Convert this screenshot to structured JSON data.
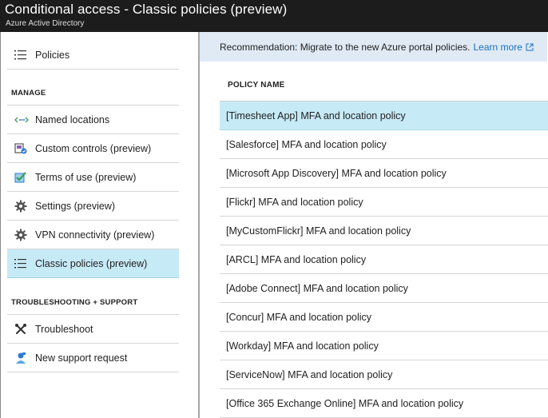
{
  "window": {
    "title": "Conditional access - Classic policies (preview)",
    "subtitle": "Azure Active Directory"
  },
  "sidebar": {
    "top_item": {
      "label": "Policies",
      "icon": "list-icon"
    },
    "manage_header": "MANAGE",
    "manage_items": [
      {
        "label": "Named locations",
        "icon": "named-locations-icon"
      },
      {
        "label": "Custom controls (preview)",
        "icon": "custom-controls-icon"
      },
      {
        "label": "Terms of use (preview)",
        "icon": "terms-of-use-icon"
      },
      {
        "label": "Settings (preview)",
        "icon": "gear-icon"
      },
      {
        "label": "VPN connectivity (preview)",
        "icon": "gear-icon"
      },
      {
        "label": "Classic policies (preview)",
        "icon": "list-icon",
        "selected": true
      }
    ],
    "support_header": "TROUBLESHOOTING + SUPPORT",
    "support_items": [
      {
        "label": "Troubleshoot",
        "icon": "wrench-icon"
      },
      {
        "label": "New support request",
        "icon": "support-request-icon"
      }
    ]
  },
  "banner": {
    "text": "Recommendation: Migrate to the new Azure portal policies.",
    "link_label": "Learn more",
    "link_icon": "external-link-icon"
  },
  "table": {
    "column_header": "POLICY NAME",
    "rows": [
      "[Timesheet App] MFA and location policy",
      "[Salesforce] MFA and location policy",
      "[Microsoft App Discovery] MFA and location policy",
      "[Flickr] MFA and location policy",
      "[MyCustomFlickr] MFA and location policy",
      "[ARCL] MFA and location policy",
      "[Adobe Connect] MFA and location policy",
      "[Concur] MFA and location policy",
      "[Workday] MFA and location policy",
      "[ServiceNow] MFA and location policy",
      "[Office 365 Exchange Online] MFA and location policy"
    ],
    "selected_row_index": 0
  },
  "colors": {
    "titlebar": "#1c1c1c",
    "selected": "#c7eaf7",
    "banner": "#dfeaf5",
    "link": "#1a6fbf"
  }
}
